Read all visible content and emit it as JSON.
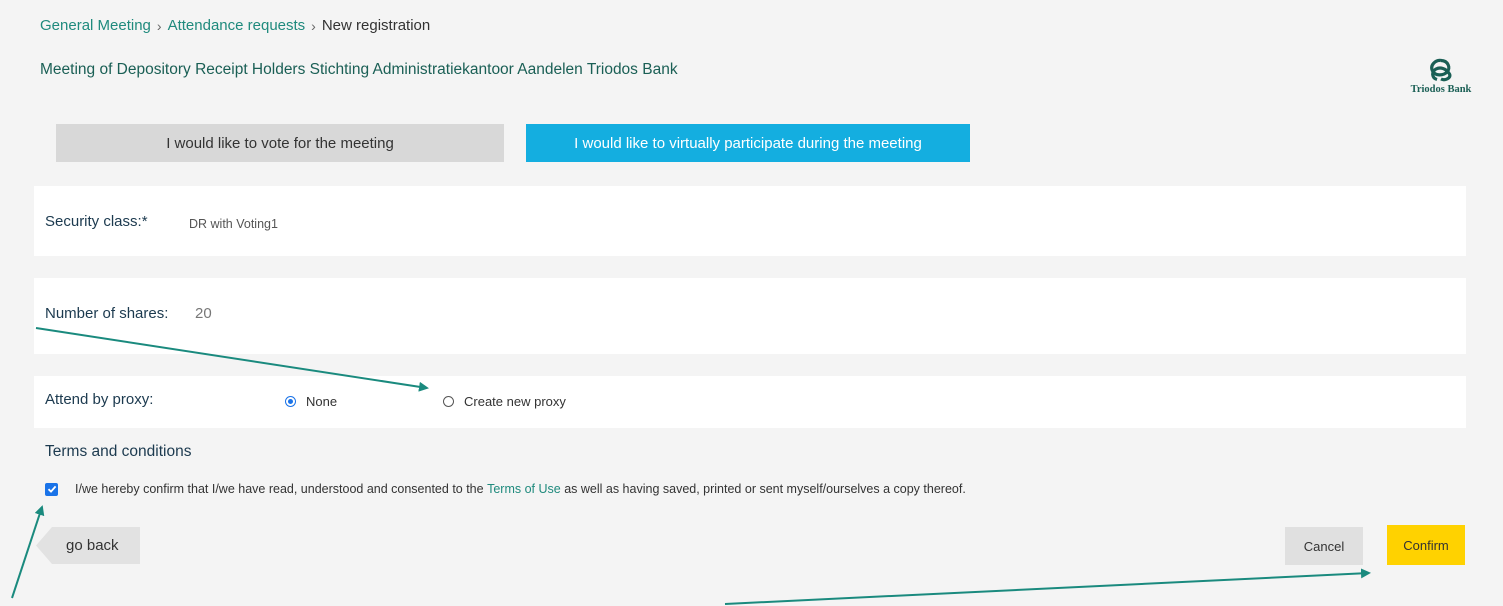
{
  "breadcrumb": {
    "item1": "General Meeting",
    "item2": "Attendance requests",
    "current": "New registration",
    "separator": "›"
  },
  "meeting": {
    "title": "Meeting of Depository Receipt Holders Stichting Administratiekantoor Aandelen Triodos Bank"
  },
  "logo": {
    "text": "Triodos Bank",
    "color": "#1a5f55"
  },
  "tabs": {
    "vote": "I would like to vote for the meeting",
    "virtual": "I would like to virtually participate during the meeting",
    "active_color": "#14aee0"
  },
  "form": {
    "security_label": "Security class:*",
    "security_value": "DR with Voting1",
    "shares_label": "Number of shares:",
    "shares_value": "20",
    "proxy_label": "Attend by proxy:",
    "proxy_options": [
      {
        "label": "None",
        "selected": true
      },
      {
        "label": "Create new proxy",
        "selected": false
      }
    ]
  },
  "terms": {
    "heading": "Terms and conditions",
    "checked": true,
    "text_before": "I/we hereby confirm that I/we have read, understood and consented to the",
    "link": "Terms of Use",
    "text_after": "as well as having saved, printed or sent myself/ourselves a copy thereof."
  },
  "actions": {
    "go_back": "go back",
    "cancel": "Cancel",
    "confirm": "Confirm",
    "confirm_color": "#ffd200"
  },
  "annotation_color": "#1a8a7e"
}
